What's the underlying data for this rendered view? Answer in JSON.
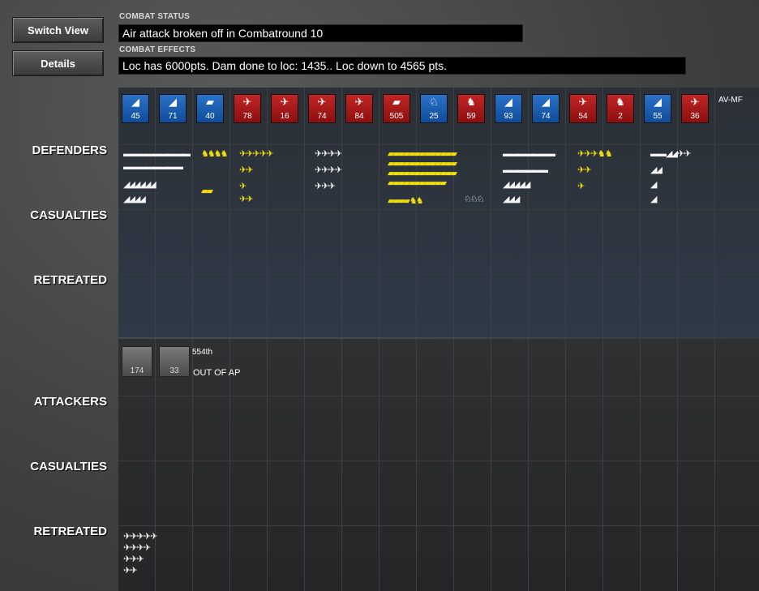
{
  "buttons": {
    "switch_view": "Switch View",
    "details": "Details"
  },
  "combat": {
    "status_label": "COMBAT STATUS",
    "status_text": "Air attack broken off in Combatround  10",
    "effects_label": "COMBAT EFFECTS",
    "effects_text": "Loc has  6000pts. Dam done to loc: 1435.. Loc down to 4565 pts."
  },
  "sections": {
    "defenders": "DEFENDERS",
    "def_casualties": "CASUALTIES",
    "def_retreated": "RETREATED",
    "attackers": "ATTACKERS",
    "att_casualties": "CASUALTIES",
    "att_retreated": "RETREATED"
  },
  "defender_units": [
    {
      "side": "blue",
      "icon": "artillery-icon",
      "value": "45"
    },
    {
      "side": "blue",
      "icon": "artillery-icon",
      "value": "71"
    },
    {
      "side": "blue",
      "icon": "tank-icon",
      "value": "40"
    },
    {
      "side": "red",
      "icon": "plane-icon",
      "value": "78"
    },
    {
      "side": "red",
      "icon": "plane-icon",
      "value": "16"
    },
    {
      "side": "red",
      "icon": "plane-icon",
      "value": "74"
    },
    {
      "side": "red",
      "icon": "plane-icon",
      "value": "84"
    },
    {
      "side": "red",
      "icon": "tank-icon",
      "value": "505"
    },
    {
      "side": "blue",
      "icon": "cavalry-icon",
      "value": "25"
    },
    {
      "side": "red",
      "icon": "infantry-icon",
      "value": "59"
    },
    {
      "side": "blue",
      "icon": "artillery-icon",
      "value": "93"
    },
    {
      "side": "blue",
      "icon": "artillery-icon",
      "value": "74"
    },
    {
      "side": "red",
      "icon": "plane-icon",
      "value": "54"
    },
    {
      "side": "red",
      "icon": "infantry-icon",
      "value": "2"
    },
    {
      "side": "blue",
      "icon": "artillery-icon",
      "value": "55"
    },
    {
      "side": "red",
      "icon": "plane-icon",
      "value": "36"
    }
  ],
  "defender_tail_label": "AV-MF",
  "attacker_units": [
    {
      "value": "174"
    },
    {
      "value": "33"
    }
  ],
  "attacker_name": "554th",
  "attacker_status": "OUT OF AP",
  "colors": {
    "blue_unit": "#1a5fb4",
    "red_unit": "#a51616",
    "swarm_yellow": "#f0e010",
    "swarm_white": "#f5f5f5"
  }
}
